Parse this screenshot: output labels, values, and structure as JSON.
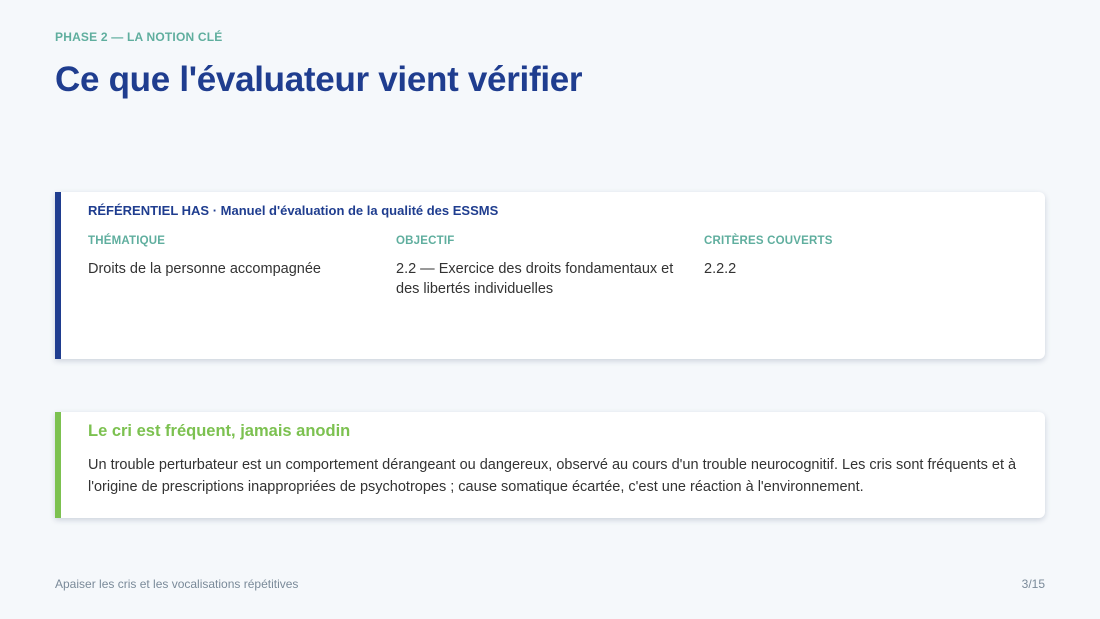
{
  "header": {
    "eyebrow": "PHASE 2 — LA NOTION CLÉ",
    "title": "Ce que l'évaluateur vient vérifier"
  },
  "referentiel": {
    "header": "RÉFÉRENTIEL HAS · Manuel d'évaluation de la qualité des ESSMS",
    "columns": [
      {
        "label": "THÉMATIQUE",
        "value": "Droits de la personne accompagnée"
      },
      {
        "label": "OBJECTIF",
        "value": "2.2 — Exercice des droits fondamentaux et des libertés individuelles"
      },
      {
        "label": "CRITÈRES COUVERTS",
        "value": "2.2.2"
      }
    ],
    "accent_color": "#1f3d8f"
  },
  "alert": {
    "title": "Le cri est fréquent, jamais anodin",
    "body": "Un trouble perturbateur est un comportement dérangeant ou dangereux, observé au cours d'un trouble neurocognitif. Les cris sont fréquents et à l'origine de prescriptions inappropriées de psychotropes ; cause somatique écartée, c'est une réaction à l'environnement.",
    "accent_color": "#7cc150"
  },
  "footer": {
    "left": "Apaiser les cris et les vocalisations répétitives",
    "page": "3/15"
  }
}
